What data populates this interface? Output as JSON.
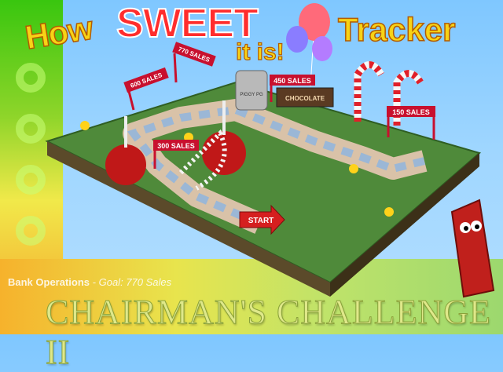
{
  "title": {
    "how": "How",
    "sweet": "SWEET",
    "it_is": "it is!",
    "tracker": "Tracker"
  },
  "milestones": [
    "150 SALES",
    "300 SALES",
    "450 SALES",
    "600 SALES",
    "770 SALES"
  ],
  "start_label": "START",
  "chocolate_label": "CHOCOLATE",
  "piggy_label": "PIGGY PG",
  "team": "Bank Operations",
  "goal_prefix": "Goal:",
  "goal_value": "770 Sales",
  "challenge_title": "CHAIRMAN'S CHALLENGE II",
  "colors": {
    "title_yellow": "#f7d316",
    "title_red": "#ff2d2d",
    "sign_red": "#c8102e",
    "board_green": "#6aa84f"
  }
}
